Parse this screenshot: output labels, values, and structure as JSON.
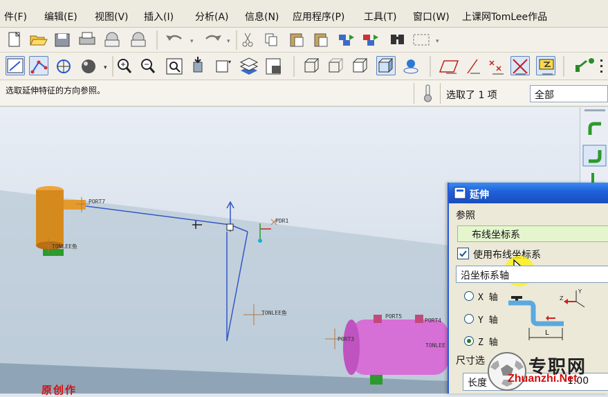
{
  "menu": {
    "items": [
      "件(F)",
      "编辑(E)",
      "视图(V)",
      "插入(I)",
      "分析(A)",
      "信息(N)",
      "应用程序(P)",
      "工具(T)",
      "窗口(W)",
      "上课网TomLee作品"
    ]
  },
  "status": {
    "message": "选取延伸特征的方向参照。",
    "selected": "选取了 1 项",
    "filter": "全部"
  },
  "viewport": {
    "labels": {
      "port7": "PORT7",
      "pdr1": "PDR1",
      "tonlee_left": "TONLEE鱼",
      "tonlee_mid": "TONLEE鱼",
      "port5": "PORT5",
      "port4": "PORT4",
      "port3": "PORT3",
      "tonlee_right": "TONLEE"
    }
  },
  "dialog": {
    "title": "延伸",
    "reference_label": "参照",
    "reference_value": "布线坐标系",
    "use_coordsys_label": "使用布线坐标系",
    "use_coordsys_checked": true,
    "direction_value": "沿坐标系轴",
    "axes": [
      {
        "label": "X 轴",
        "selected": false
      },
      {
        "label": "Y 轴",
        "selected": false
      },
      {
        "label": "Z 轴",
        "selected": true
      }
    ],
    "diagram_L": "L",
    "diagram_axis_y": "Y",
    "diagram_axis_z": "Z",
    "size_option_label": "尺寸选",
    "length_value": "长度",
    "length_number": "1.00"
  },
  "watermark": {
    "big": "专职网",
    "small": "Zhuanzhi.Net"
  },
  "banner": {
    "text": "原创作"
  },
  "icons": {
    "toolbar1": [
      "new-icon",
      "open-icon",
      "save-icon",
      "print-icon",
      "send-mail-icon",
      "send-mail-alt-icon",
      "undo-icon",
      "redo-icon",
      "cut-icon",
      "copy-icon",
      "paste-icon",
      "paste-special-icon",
      "regenerate-icon",
      "regenerate-manager-icon",
      "find-icon",
      "select-box-icon"
    ],
    "toolbar2": [
      "sketch-view-icon",
      "route-icon",
      "orient-icon",
      "sphere-shading-icon",
      "zoom-in-icon",
      "zoom-out-icon",
      "refit-icon",
      "saved-view-icon",
      "orient-mode-icon",
      "layer-icon",
      "view-manager-icon",
      "wireframe-icon",
      "hidden-line-icon",
      "no-hidden-icon",
      "shading-icon",
      "spin-center-icon",
      "datum-plane-icon",
      "datum-axis-icon",
      "datum-point-icon",
      "datum-point-x-icon",
      "coordsys-icon",
      "annotation-icon"
    ]
  }
}
